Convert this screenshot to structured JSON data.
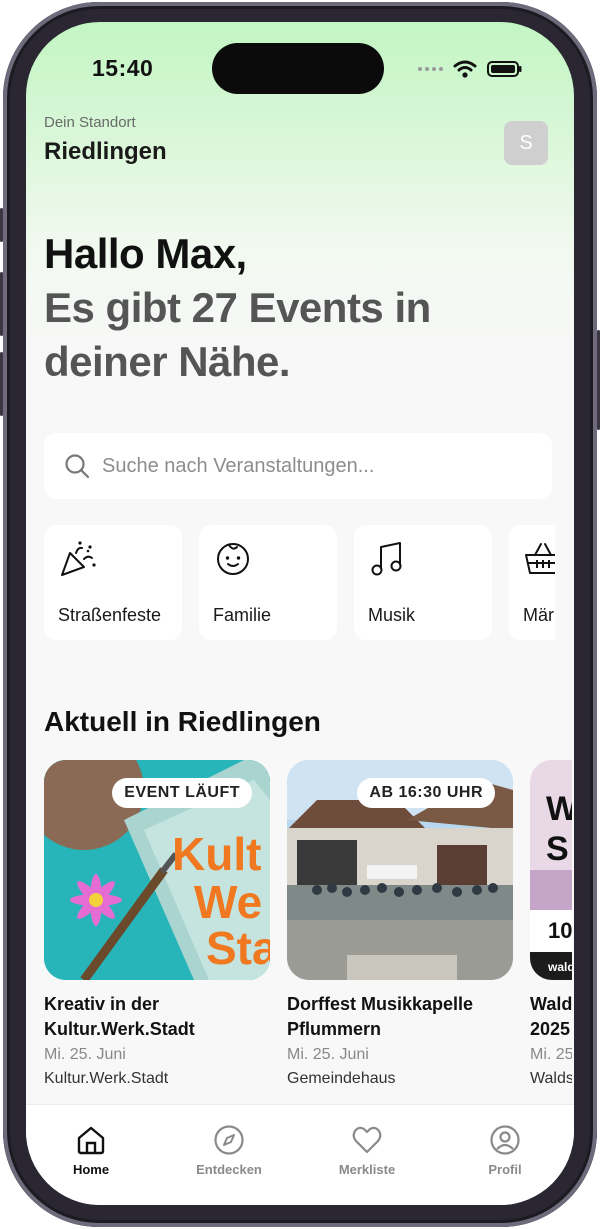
{
  "status_bar": {
    "time": "15:40"
  },
  "location": {
    "label": "Dein Standort",
    "name": "Riedlingen"
  },
  "avatar": {
    "initial": "S"
  },
  "greeting": {
    "line1": "Hallo Max,",
    "line2": "Es gibt 27 Events in deiner Nähe."
  },
  "search": {
    "placeholder": "Suche nach Veranstaltungen..."
  },
  "categories": [
    {
      "label": "Straßenfeste",
      "icon": "party-popper-icon"
    },
    {
      "label": "Familie",
      "icon": "baby-face-icon"
    },
    {
      "label": "Musik",
      "icon": "music-note-icon"
    },
    {
      "label": "Märkte",
      "icon": "basket-icon"
    }
  ],
  "section": {
    "title": "Aktuell in Riedlingen"
  },
  "events": [
    {
      "badge": "EVENT LÄUFT",
      "title": "Kreativ in der Kultur.Werk.Stadt",
      "date": "Mi. 25. Juni",
      "venue": "Kultur.Werk.Stadt",
      "image_text": "Kult We Sta"
    },
    {
      "badge": "AB 16:30 UHR",
      "title": "Dorffest Musikkapelle Pflummern",
      "date": "Mi. 25. Juni",
      "venue": "Gemeindehaus"
    },
    {
      "title": "Wald 2025",
      "date": "Mi. 25",
      "venue": "Walds",
      "image_text": "W S 10 wald"
    }
  ],
  "tabs": [
    {
      "label": "Home",
      "icon": "home-icon",
      "active": true
    },
    {
      "label": "Entdecken",
      "icon": "compass-icon"
    },
    {
      "label": "Merkliste",
      "icon": "heart-icon"
    },
    {
      "label": "Profil",
      "icon": "profile-icon"
    }
  ],
  "colors": {
    "accent_gradient_top": "#c3f5c3",
    "background": "#f8f8f8",
    "badge_orange": "#f07820"
  }
}
